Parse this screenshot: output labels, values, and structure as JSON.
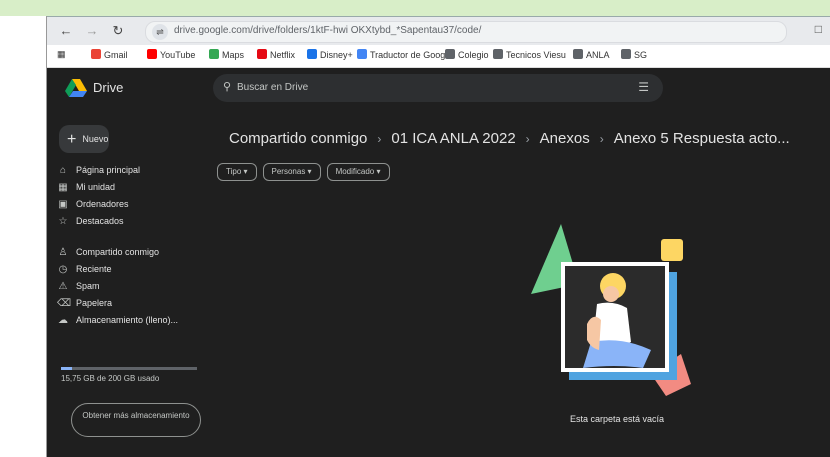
{
  "browser": {
    "url": "drive.google.com/drive/folders/1ktF-hwi OKXtybd_*Sapentau37/code/",
    "bookmarks": [
      {
        "label": "Gmail",
        "icon": "gmail-icon",
        "color": "#ea4335"
      },
      {
        "label": "YouTube",
        "icon": "youtube-icon",
        "color": "#ff0000"
      },
      {
        "label": "Maps",
        "icon": "maps-icon",
        "color": "#34a853"
      },
      {
        "label": "Netflix",
        "icon": "netflix-icon",
        "color": "#e50914"
      },
      {
        "label": "Disney+",
        "icon": "disney-icon",
        "color": "#1a73e8"
      },
      {
        "label": "Traductor de Google",
        "icon": "translate-icon",
        "color": "#4285f4"
      },
      {
        "label": "Colegio",
        "icon": "folder-icon",
        "color": "#5f6368"
      },
      {
        "label": "Tecnicos Viesu",
        "icon": "folder-icon",
        "color": "#5f6368"
      },
      {
        "label": "ANLA",
        "icon": "folder-icon",
        "color": "#5f6368"
      },
      {
        "label": "SG",
        "icon": "folder-icon",
        "color": "#5f6368"
      }
    ]
  },
  "drive": {
    "app_name": "Drive",
    "search_placeholder": "Buscar en Drive",
    "new_label": "Nuevo",
    "nav": [
      {
        "label": "Página principal",
        "icon": "home-icon"
      },
      {
        "label": "Mi unidad",
        "icon": "my-drive-icon"
      },
      {
        "label": "Ordenadores",
        "icon": "computers-icon"
      },
      {
        "label": "Destacados",
        "icon": "star-icon"
      },
      {
        "label": "Compartido conmigo",
        "icon": "shared-icon"
      },
      {
        "label": "Reciente",
        "icon": "recent-icon"
      },
      {
        "label": "Spam",
        "icon": "spam-icon"
      },
      {
        "label": "Papelera",
        "icon": "trash-icon"
      },
      {
        "label": "Almacenamiento (lleno)...",
        "icon": "cloud-icon"
      }
    ],
    "storage_text": "15,75 GB de 200 GB usado",
    "storage_percent": 8,
    "get_storage_label": "Obtener más almacenamiento",
    "breadcrumb": [
      "Compartido conmigo",
      "01 ICA ANLA 2022",
      "Anexos",
      "Anexo 5 Respuesta acto..."
    ],
    "filters": [
      "Tipo",
      "Personas",
      "Modificado"
    ],
    "empty_message": "Esta carpeta está vacía"
  }
}
